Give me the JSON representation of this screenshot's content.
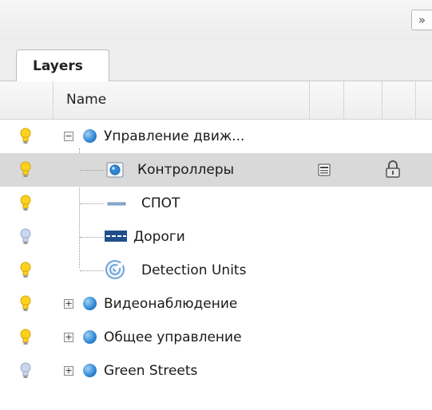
{
  "panel": {
    "collapse_glyph": "»",
    "tab_label": "Layers",
    "column_name": "Name"
  },
  "layers": [
    {
      "label": "Управление движ...",
      "visible": true,
      "expander": "minus"
    },
    {
      "label": "Контроллеры",
      "visible": true,
      "selected": true,
      "icon": "point-layer-icon",
      "actions": [
        "properties-icon",
        "lock-icon"
      ]
    },
    {
      "label": "СПОТ",
      "visible": true,
      "icon": "line-layer-icon"
    },
    {
      "label": "Дороги",
      "visible": false,
      "icon": "road-layer-icon"
    },
    {
      "label": "Detection Units",
      "visible": true,
      "icon": "detection-layer-icon"
    },
    {
      "label": "Видеонаблюдение",
      "visible": true,
      "expander": "plus"
    },
    {
      "label": "Общее управление",
      "visible": true,
      "expander": "plus"
    },
    {
      "label": "Green Streets",
      "visible": false,
      "expander": "plus"
    }
  ],
  "colors": {
    "bulb_on": "#ffd21f",
    "bulb_off": "#c9d6ee",
    "selection": "#d9d9d9",
    "group_ball": "#2f86d3"
  }
}
